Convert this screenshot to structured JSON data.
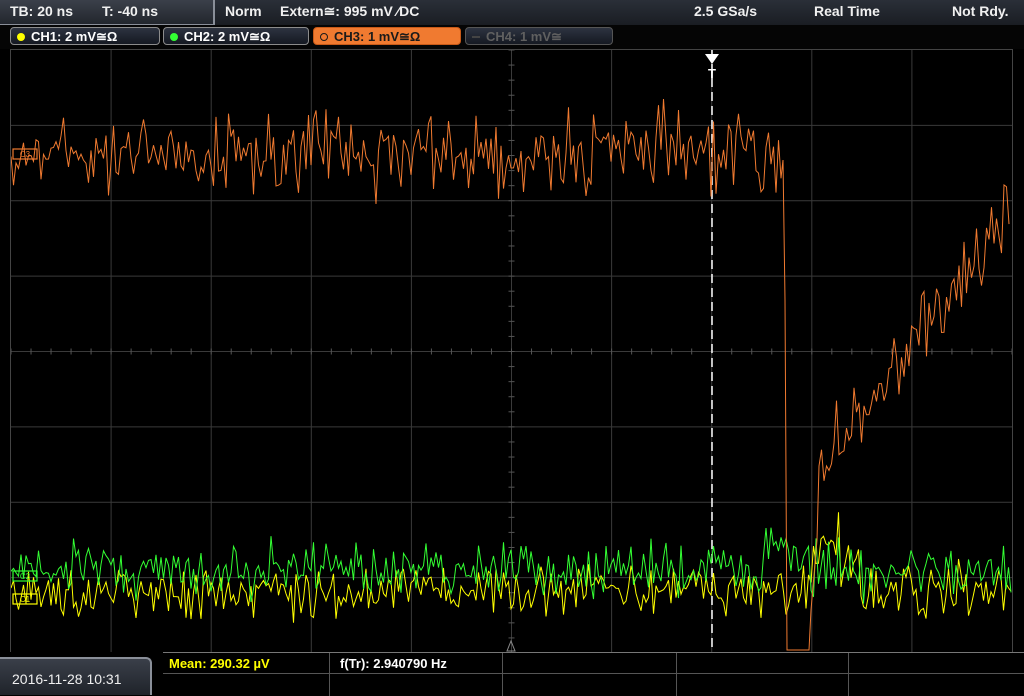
{
  "status": {
    "timebase": "TB: 20 ns",
    "trigger_pos": "T: -40 ns",
    "mode": "Norm",
    "trigger_source": "Extern≅: 995 mV ∕DC",
    "sample_rate": "2.5 GSa/s",
    "acq_mode": "Real Time",
    "state": "Not Rdy."
  },
  "channels": [
    {
      "label": "CH1: 2 mV≅Ω",
      "color": "#ffff00",
      "state": "on"
    },
    {
      "label": "CH2: 2 mV≅Ω",
      "color": "#33ff33",
      "state": "on"
    },
    {
      "label": "CH3: 1 mV≅Ω",
      "color": "#f07a30",
      "state": "active"
    },
    {
      "label": "CH4: 1 mV≅",
      "color": "#606060",
      "state": "off"
    }
  ],
  "markers": {
    "trigger": "T",
    "ch3": "C3",
    "ch2": "C2",
    "ch1": "C1"
  },
  "footer": {
    "datetime": "2016-11-28 10:31",
    "mean": "Mean: 290.32 µV",
    "freq": "f(Tr): 2.940790 Hz"
  },
  "colors": {
    "ch1": "#ffff00",
    "ch2": "#33ff33",
    "ch3": "#f07a30",
    "grid": "#3a3a3a"
  }
}
